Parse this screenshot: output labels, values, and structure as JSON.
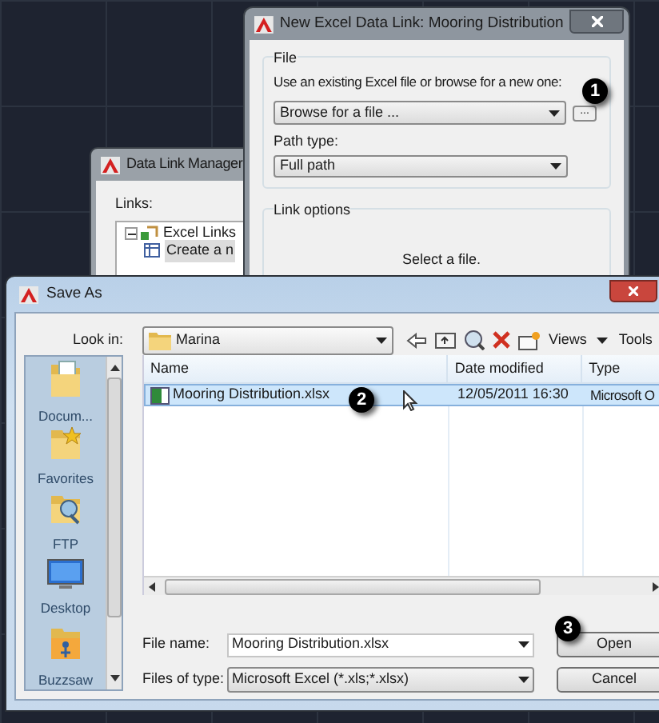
{
  "excel_link_window": {
    "title": "New Excel Data Link: Mooring Distribution",
    "file_group": "File",
    "prompt": "Use an existing Excel file or browse for a new one:",
    "file_dropdown": "Browse for a file ...",
    "browse_button": "...",
    "path_type_label": "Path type:",
    "path_type_dropdown": "Full path",
    "link_options_group": "Link options",
    "message": "Select a file."
  },
  "data_link_manager": {
    "title": "Data Link Manager",
    "links_label": "Links:",
    "tree": [
      {
        "label": "Excel Links",
        "expanded": true,
        "children": [
          {
            "label": "Create a n",
            "selected": true
          }
        ]
      }
    ]
  },
  "save_as": {
    "title": "Save As",
    "look_in_label": "Look in:",
    "look_in_value": "Marina",
    "views": "Views",
    "tools": "Tools",
    "places": [
      {
        "label": "Docum...",
        "kind": "documents"
      },
      {
        "label": "Favorites",
        "kind": "favorites"
      },
      {
        "label": "FTP",
        "kind": "ftp"
      },
      {
        "label": "Desktop",
        "kind": "desktop"
      },
      {
        "label": "Buzzsaw",
        "kind": "buzzsaw"
      }
    ],
    "columns": [
      "Name",
      "Date modified",
      "Type"
    ],
    "rows": [
      {
        "name": "Mooring Distribution.xlsx",
        "date": "12/05/2011 16:30",
        "type": "Microsoft O",
        "selected": true
      }
    ],
    "file_name_label": "File name:",
    "file_name_value": "Mooring Distribution.xlsx",
    "file_type_label": "Files of type:",
    "file_type_value": "Microsoft Excel (*.xls;*.xlsx)",
    "buttons": [
      "Open",
      "Cancel"
    ]
  },
  "callouts": [
    "1",
    "2",
    "3"
  ]
}
